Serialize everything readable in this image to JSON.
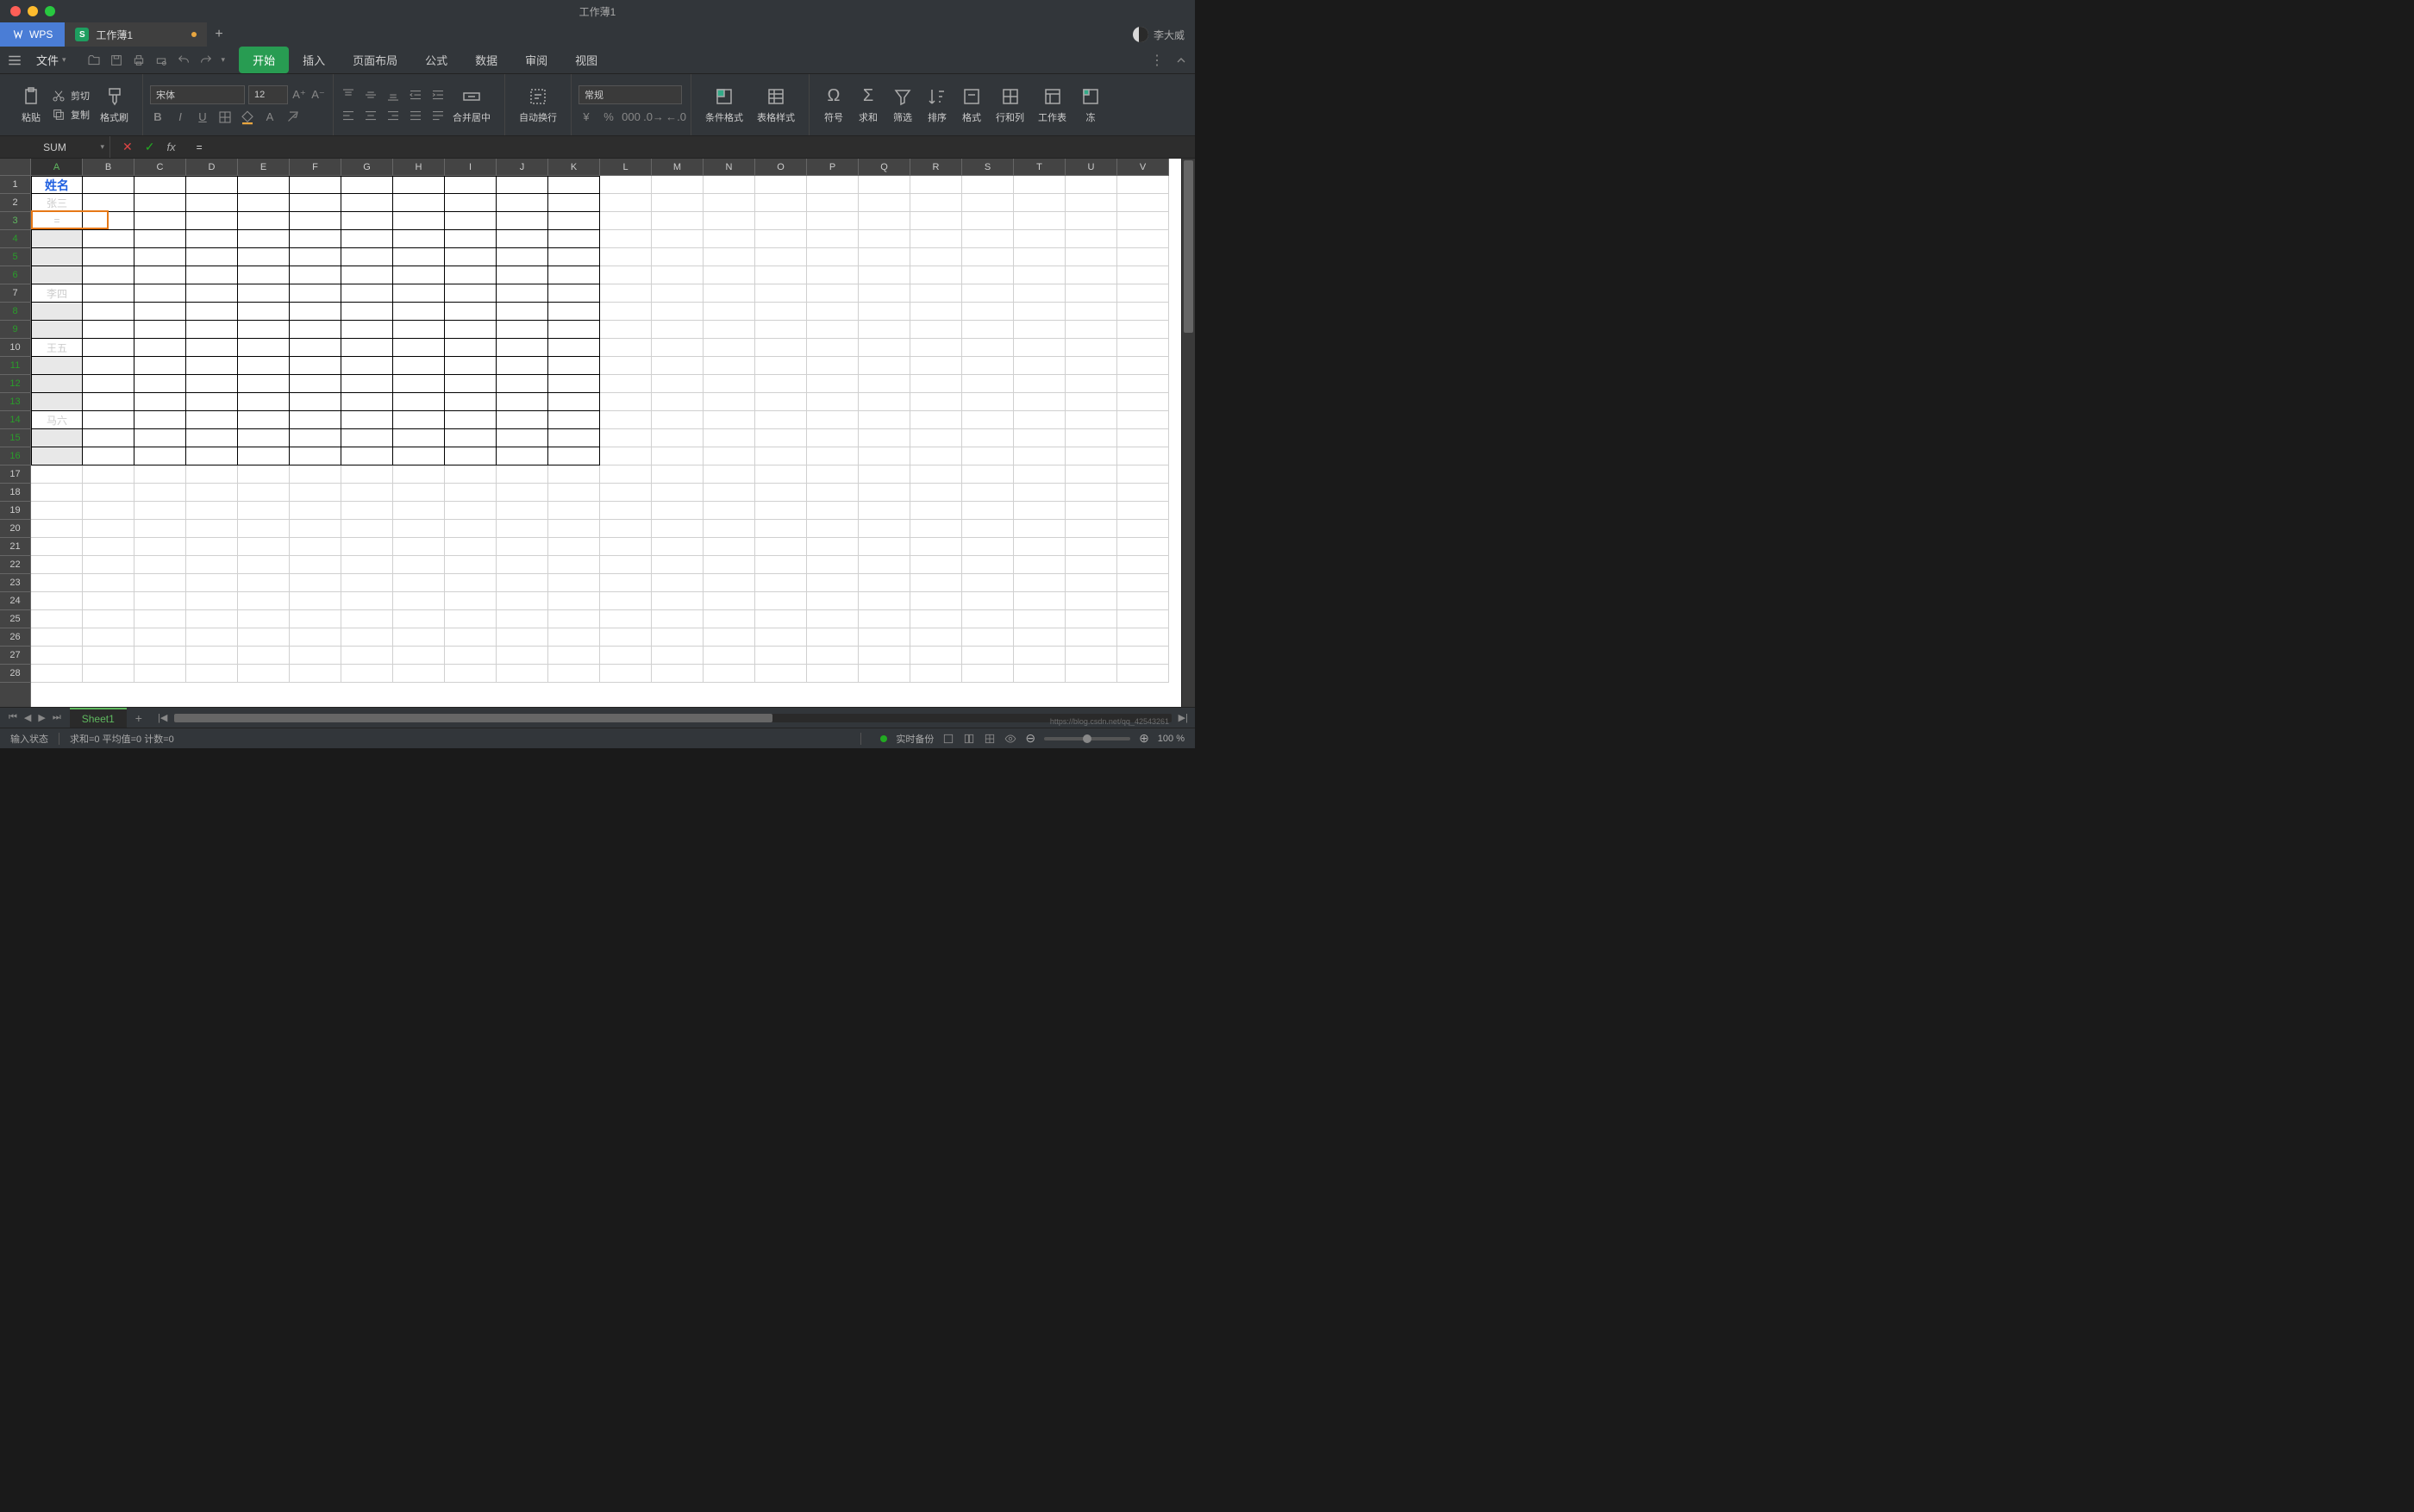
{
  "title": "工作薄1",
  "wps_label": "WPS",
  "doc_tab": "工作薄1",
  "user_name": "李大威",
  "file_menu": "文件",
  "ribbon_tabs": [
    "开始",
    "插入",
    "页面布局",
    "公式",
    "数据",
    "审阅",
    "视图"
  ],
  "active_tab_index": 0,
  "clipboard": {
    "paste": "粘贴",
    "cut": "剪切",
    "copy": "复制",
    "brush": "格式刷"
  },
  "font": {
    "name": "宋体",
    "size": "12"
  },
  "merge": "合并居中",
  "wrap": "自动换行",
  "number_format": "常规",
  "cond_fmt": "条件格式",
  "table_style": "表格样式",
  "symbols": "符号",
  "sum": "求和",
  "filter": "筛选",
  "sort": "排序",
  "format": "格式",
  "row_col": "行和列",
  "worksheet": "工作表",
  "freeze": "冻",
  "namebox": "SUM",
  "formula_value": "=",
  "columns": [
    "A",
    "B",
    "C",
    "D",
    "E",
    "F",
    "G",
    "H",
    "I",
    "J",
    "K",
    "L",
    "M",
    "N",
    "O",
    "P",
    "Q",
    "R",
    "S",
    "T",
    "U",
    "V"
  ],
  "active_col_index": 0,
  "cursor_row_index": 2,
  "green_row_indices": [
    2,
    3,
    4,
    5,
    7,
    8,
    10,
    11,
    12,
    13,
    14,
    15
  ],
  "cells_A": {
    "1": "姓名",
    "2": "张三",
    "3": "=",
    "7": "李四",
    "10": "王五",
    "14": "马六"
  },
  "bordered_rows": 16,
  "bordered_cols": 11,
  "sheet_tab": "Sheet1",
  "status_left": "输入状态",
  "status_calc": "求和=0  平均值=0  计数=0",
  "live_backup": "实时备份",
  "zoom": "100 %",
  "watermark": "https://blog.csdn.net/qq_42543261"
}
